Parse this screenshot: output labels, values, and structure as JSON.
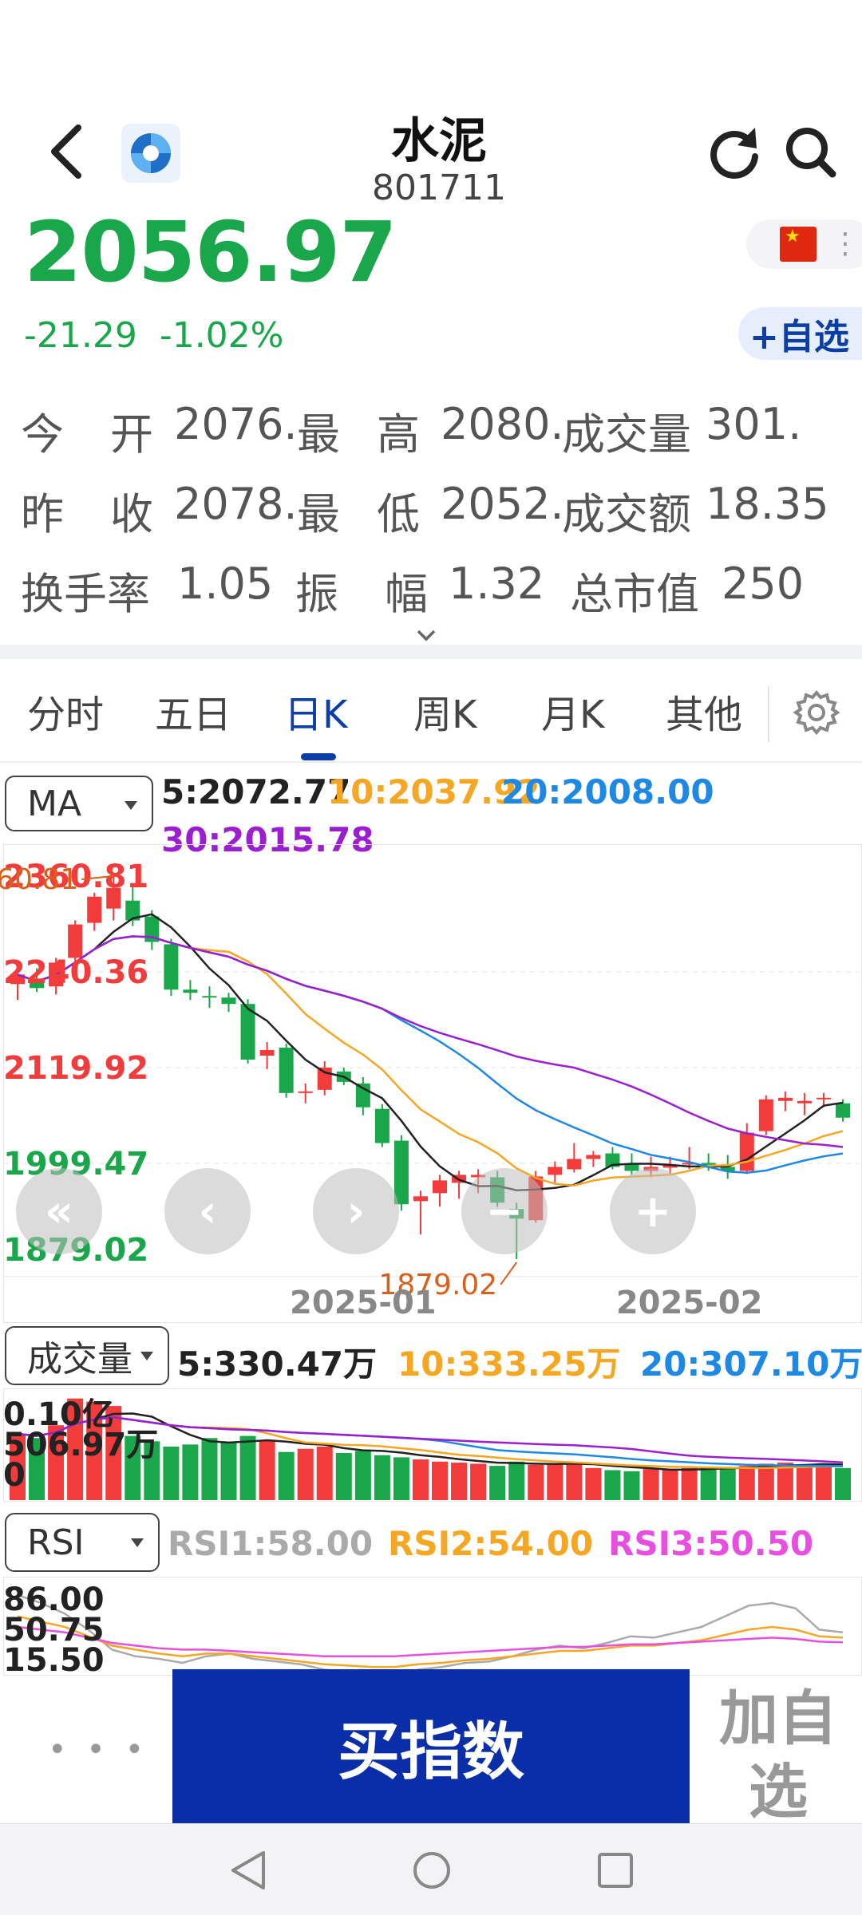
{
  "header": {
    "title": "水泥",
    "code": "801711",
    "price": "2056.97",
    "change": "-21.29",
    "change_pct": "-1.02%",
    "fav_label": "+自选",
    "icons": [
      "back-icon",
      "logo-icon",
      "refresh-icon",
      "search-icon",
      "china-flag-icon",
      "kebab-icon"
    ]
  },
  "stats": {
    "row1": {
      "k1": "今",
      "k1b": "开",
      "v1": "2076.",
      "k2": "最",
      "k2b": "高",
      "v2": "2080.",
      "k3": "成交量",
      "v3": "301."
    },
    "row2": {
      "k1": "昨",
      "k1b": "收",
      "v1": "2078.",
      "k2": "最",
      "k2b": "低",
      "v2": "2052.",
      "k3": "成交额",
      "v3": "18.35"
    },
    "row3": {
      "k1": "换手率",
      "v1": "1.05",
      "k2": "振",
      "k2b": "幅",
      "v2": "1.32",
      "k3": "总市值",
      "v3": "250"
    },
    "expand_icon": "chevron-down-icon"
  },
  "tabs": [
    {
      "label": "分时",
      "active": false
    },
    {
      "label": "五日",
      "active": false
    },
    {
      "label": "日K",
      "active": true
    },
    {
      "label": "周K",
      "active": false
    },
    {
      "label": "月K",
      "active": false
    },
    {
      "label": "其他",
      "active": false
    }
  ],
  "main_chart": {
    "indicator_select": "MA",
    "ma5": "5:2072.77",
    "ma10": "10:2037.92",
    "ma20": "20:2008.00",
    "ma30": "30:2015.78",
    "y_ticks": [
      "2360.81",
      "2240.36",
      "2119.92",
      "1999.47",
      "1879.02"
    ],
    "high_label": "2360.81",
    "low_label": "1879.02",
    "x_ticks": [
      "2025-01",
      "2025-02"
    ],
    "colors": {
      "up": "#f23b3b",
      "down": "#1aa64a",
      "ma5": "#222222",
      "ma10": "#f5a623",
      "ma20": "#1e88e5",
      "ma30": "#9b1fd1"
    }
  },
  "volume_chart": {
    "indicator_select": "成交量",
    "ma5": "5:330.47万",
    "ma10": "10:333.25万",
    "ma20": "20:307.10万",
    "y_ticks": [
      "0.10亿",
      "506.97万",
      "0"
    ]
  },
  "rsi_chart": {
    "indicator_select": "RSI",
    "rsi1": "RSI1:58.00",
    "rsi2": "RSI2:54.00",
    "rsi3": "RSI3:50.50",
    "y_ticks": [
      "86.00",
      "50.75",
      "15.50"
    ]
  },
  "bottom": {
    "more_label": "• • •",
    "buy_label": "买指数",
    "add_fav_label": "加自选"
  },
  "chart_data": {
    "type": "candlestick",
    "y_axis": [
      1879.02,
      2360.81
    ],
    "x_ticks": [
      "2025-01",
      "2025-02"
    ],
    "candles": [
      {
        "o": 2225,
        "h": 2242,
        "l": 2205,
        "c": 2237
      },
      {
        "o": 2232,
        "h": 2245,
        "l": 2215,
        "c": 2220
      },
      {
        "o": 2222,
        "h": 2258,
        "l": 2212,
        "c": 2252
      },
      {
        "o": 2258,
        "h": 2305,
        "l": 2248,
        "c": 2300
      },
      {
        "o": 2302,
        "h": 2340,
        "l": 2292,
        "c": 2335
      },
      {
        "o": 2320,
        "h": 2360.81,
        "l": 2305,
        "c": 2346
      },
      {
        "o": 2330,
        "h": 2348,
        "l": 2298,
        "c": 2305
      },
      {
        "o": 2310,
        "h": 2318,
        "l": 2268,
        "c": 2278
      },
      {
        "o": 2275,
        "h": 2282,
        "l": 2210,
        "c": 2218
      },
      {
        "o": 2218,
        "h": 2230,
        "l": 2205,
        "c": 2214
      },
      {
        "o": 2210,
        "h": 2222,
        "l": 2195,
        "c": 2208
      },
      {
        "o": 2208,
        "h": 2214,
        "l": 2190,
        "c": 2200
      },
      {
        "o": 2200,
        "h": 2206,
        "l": 2125,
        "c": 2130
      },
      {
        "o": 2135,
        "h": 2152,
        "l": 2118,
        "c": 2142
      },
      {
        "o": 2145,
        "h": 2150,
        "l": 2082,
        "c": 2088
      },
      {
        "o": 2090,
        "h": 2100,
        "l": 2075,
        "c": 2090
      },
      {
        "o": 2092,
        "h": 2128,
        "l": 2085,
        "c": 2120
      },
      {
        "o": 2115,
        "h": 2120,
        "l": 2098,
        "c": 2102
      },
      {
        "o": 2100,
        "h": 2108,
        "l": 2060,
        "c": 2070
      },
      {
        "o": 2068,
        "h": 2074,
        "l": 2020,
        "c": 2025
      },
      {
        "o": 2028,
        "h": 2035,
        "l": 1940,
        "c": 1948
      },
      {
        "o": 1952,
        "h": 1965,
        "l": 1910,
        "c": 1958
      },
      {
        "o": 1962,
        "h": 1985,
        "l": 1945,
        "c": 1978
      },
      {
        "o": 1975,
        "h": 1990,
        "l": 1955,
        "c": 1985
      },
      {
        "o": 1982,
        "h": 1992,
        "l": 1962,
        "c": 1985
      },
      {
        "o": 1982,
        "h": 1990,
        "l": 1945,
        "c": 1950
      },
      {
        "o": 1942,
        "h": 1950,
        "l": 1879.02,
        "c": 1930
      },
      {
        "o": 1928,
        "h": 1990,
        "l": 1925,
        "c": 1983
      },
      {
        "o": 1985,
        "h": 2002,
        "l": 1975,
        "c": 1995
      },
      {
        "o": 1992,
        "h": 2025,
        "l": 1988,
        "c": 2005
      },
      {
        "o": 2005,
        "h": 2015,
        "l": 1995,
        "c": 2010
      },
      {
        "o": 2012,
        "h": 2020,
        "l": 1992,
        "c": 1995
      },
      {
        "o": 1998,
        "h": 2012,
        "l": 1985,
        "c": 1990
      },
      {
        "o": 1990,
        "h": 2008,
        "l": 1982,
        "c": 1995
      },
      {
        "o": 1994,
        "h": 2008,
        "l": 1986,
        "c": 1998
      },
      {
        "o": 1998,
        "h": 2020,
        "l": 1992,
        "c": 2000
      },
      {
        "o": 2000,
        "h": 2012,
        "l": 1990,
        "c": 1995
      },
      {
        "o": 1995,
        "h": 2010,
        "l": 1980,
        "c": 1990
      },
      {
        "o": 1990,
        "h": 2050,
        "l": 1986,
        "c": 2038
      },
      {
        "o": 2040,
        "h": 2085,
        "l": 2035,
        "c": 2080
      },
      {
        "o": 2078,
        "h": 2090,
        "l": 2065,
        "c": 2082
      },
      {
        "o": 2075,
        "h": 2088,
        "l": 2060,
        "c": 2078
      },
      {
        "o": 2080,
        "h": 2088,
        "l": 2070,
        "c": 2082
      },
      {
        "o": 2075,
        "h": 2080,
        "l": 2052,
        "c": 2056.97
      }
    ],
    "volume": [
      0.62,
      0.58,
      0.7,
      0.95,
      0.92,
      0.88,
      0.6,
      0.55,
      0.5,
      0.52,
      0.58,
      0.54,
      0.6,
      0.56,
      0.45,
      0.48,
      0.5,
      0.44,
      0.46,
      0.42,
      0.4,
      0.38,
      0.36,
      0.35,
      0.34,
      0.32,
      0.36,
      0.33,
      0.34,
      0.35,
      0.3,
      0.28,
      0.27,
      0.29,
      0.28,
      0.3,
      0.31,
      0.3,
      0.32,
      0.34,
      0.35,
      0.33,
      0.34,
      0.3
    ],
    "rsi1": [
      86,
      80,
      72,
      60,
      45,
      40,
      38,
      35,
      40,
      42,
      38,
      36,
      34,
      30,
      28,
      26,
      25,
      30,
      32,
      35,
      36,
      40,
      45,
      48,
      46,
      50,
      55,
      54,
      58,
      62,
      70,
      78,
      80,
      76,
      60,
      58
    ],
    "rsi2": [
      70,
      66,
      62,
      55,
      48,
      45,
      42,
      40,
      42,
      42,
      40,
      38,
      36,
      34,
      33,
      32,
      32,
      34,
      35,
      37,
      38,
      40,
      42,
      44,
      44,
      46,
      48,
      48,
      50,
      52,
      56,
      60,
      62,
      60,
      55,
      54
    ],
    "rsi3": [
      62,
      60,
      58,
      54,
      50,
      48,
      46,
      45,
      45,
      44,
      43,
      42,
      41,
      40,
      40,
      40,
      40,
      41,
      42,
      43,
      44,
      45,
      46,
      47,
      47,
      48,
      49,
      49,
      50,
      51,
      52,
      53,
      54,
      53,
      51,
      50.5
    ]
  }
}
